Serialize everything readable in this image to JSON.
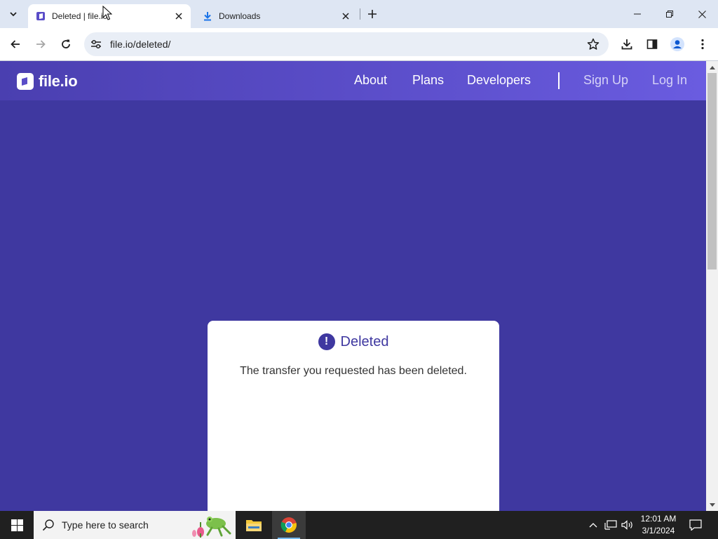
{
  "browser": {
    "tabs": [
      {
        "title": "Deleted | file.io",
        "active": true,
        "favicon": "fileio-favicon"
      },
      {
        "title": "Downloads",
        "active": false,
        "favicon": "download-icon"
      }
    ],
    "url": "file.io/deleted/"
  },
  "site": {
    "logo_text": "file.io",
    "nav": {
      "about": "About",
      "plans": "Plans",
      "developers": "Developers",
      "sign_up": "Sign Up",
      "log_in": "Log In"
    }
  },
  "card": {
    "icon": "!",
    "title": "Deleted",
    "message": "The transfer you requested has been deleted."
  },
  "taskbar": {
    "search_placeholder": "Type here to search",
    "time": "12:01 AM",
    "date": "3/1/2024"
  },
  "colors": {
    "page_bg": "#3f38a0",
    "header_gradient_end": "#6a5ce0",
    "card_bg": "#ffffff",
    "accent": "#3f38a0"
  }
}
